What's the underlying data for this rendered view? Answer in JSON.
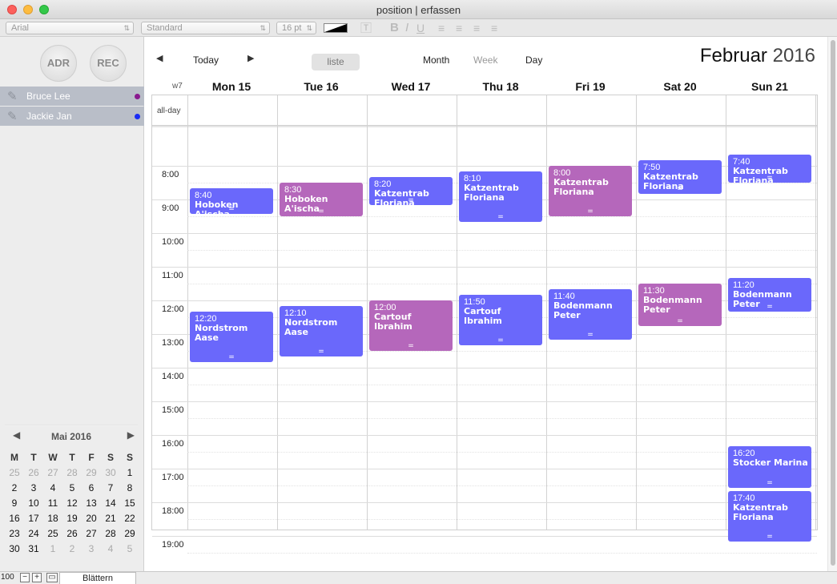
{
  "window": {
    "title": "position | erfassen"
  },
  "format_toolbar": {
    "font": "Arial",
    "style": "Standard",
    "size": "16 pt"
  },
  "sidebar": {
    "buttons": [
      {
        "label": "ADR"
      },
      {
        "label": "REC"
      }
    ],
    "persons": [
      {
        "name": "Bruce Lee",
        "dot_color": "#8a1a8f"
      },
      {
        "name": "Jackie Jan",
        "dot_color": "#1a2cf5"
      }
    ]
  },
  "mini_calendar": {
    "title": "Mai 2016",
    "dow": [
      "M",
      "T",
      "W",
      "T",
      "F",
      "S",
      "S"
    ],
    "weeks": [
      [
        {
          "d": "25",
          "dim": true
        },
        {
          "d": "26",
          "dim": true
        },
        {
          "d": "27",
          "dim": true
        },
        {
          "d": "28",
          "dim": true
        },
        {
          "d": "29",
          "dim": true
        },
        {
          "d": "30",
          "dim": true
        },
        {
          "d": "1",
          "dim": false
        }
      ],
      [
        {
          "d": "2",
          "dim": false
        },
        {
          "d": "3",
          "dim": false
        },
        {
          "d": "4",
          "dim": false
        },
        {
          "d": "5",
          "dim": false
        },
        {
          "d": "6",
          "dim": false
        },
        {
          "d": "7",
          "dim": false
        },
        {
          "d": "8",
          "dim": false
        }
      ],
      [
        {
          "d": "9",
          "dim": false
        },
        {
          "d": "10",
          "dim": false
        },
        {
          "d": "11",
          "dim": false
        },
        {
          "d": "12",
          "dim": false
        },
        {
          "d": "13",
          "dim": false
        },
        {
          "d": "14",
          "dim": false
        },
        {
          "d": "15",
          "dim": false
        }
      ],
      [
        {
          "d": "16",
          "dim": false
        },
        {
          "d": "17",
          "dim": false
        },
        {
          "d": "18",
          "dim": false
        },
        {
          "d": "19",
          "dim": false
        },
        {
          "d": "20",
          "dim": false
        },
        {
          "d": "21",
          "dim": false
        },
        {
          "d": "22",
          "dim": false
        }
      ],
      [
        {
          "d": "23",
          "dim": false
        },
        {
          "d": "24",
          "dim": false
        },
        {
          "d": "25",
          "dim": false
        },
        {
          "d": "26",
          "dim": false
        },
        {
          "d": "27",
          "dim": false
        },
        {
          "d": "28",
          "dim": false
        },
        {
          "d": "29",
          "dim": false
        }
      ],
      [
        {
          "d": "30",
          "dim": false
        },
        {
          "d": "31",
          "dim": false
        },
        {
          "d": "1",
          "dim": true
        },
        {
          "d": "2",
          "dim": true
        },
        {
          "d": "3",
          "dim": true
        },
        {
          "d": "4",
          "dim": true
        },
        {
          "d": "5",
          "dim": true
        }
      ]
    ]
  },
  "bottom_bar": {
    "zoom": "100",
    "tab_label": "Blättern"
  },
  "calendar": {
    "nav": {
      "today": "Today",
      "liste": "liste",
      "month": "Month",
      "week": "Week",
      "day": "Day"
    },
    "month_name": "Februar",
    "year": "2016",
    "week_label": "w7",
    "allday_label": "all-day",
    "days": [
      "Mon 15",
      "Tue 16",
      "Wed 17",
      "Thu 18",
      "Fri 19",
      "Sat 20",
      "Sun 21"
    ],
    "hours": [
      "8:00",
      "9:00",
      "10:00",
      "11:00",
      "12:00",
      "13:00",
      "14:00",
      "15:00",
      "16:00",
      "17:00",
      "18:00",
      "19:00"
    ],
    "handle_glyph": "=",
    "events": [
      {
        "day": 0,
        "start": 8.67,
        "end": 9.42,
        "time": "8:40",
        "title": "Hoboken A'ischa",
        "color": "blue"
      },
      {
        "day": 1,
        "start": 8.5,
        "end": 9.5,
        "time": "8:30",
        "title": "Hoboken A'ischa",
        "color": "purple"
      },
      {
        "day": 2,
        "start": 8.33,
        "end": 9.17,
        "time": "8:20",
        "title": "Katzentrab Floriana",
        "color": "blue"
      },
      {
        "day": 3,
        "start": 8.17,
        "end": 9.67,
        "time": "8:10",
        "title": "Katzentrab Floriana",
        "color": "blue"
      },
      {
        "day": 4,
        "start": 8.0,
        "end": 9.5,
        "time": "8:00",
        "title": "Katzentrab Floriana",
        "color": "purple"
      },
      {
        "day": 5,
        "start": 7.83,
        "end": 8.83,
        "time": "7:50",
        "title": "Katzentrab Floriana",
        "color": "blue"
      },
      {
        "day": 6,
        "start": 7.67,
        "end": 8.5,
        "time": "7:40",
        "title": "Katzentrab Floriana",
        "color": "blue"
      },
      {
        "day": 0,
        "start": 12.33,
        "end": 13.83,
        "time": "12:20",
        "title": "Nordstrom Aase",
        "color": "blue"
      },
      {
        "day": 1,
        "start": 12.17,
        "end": 13.67,
        "time": "12:10",
        "title": "Nordstrom Aase",
        "color": "blue"
      },
      {
        "day": 2,
        "start": 12.0,
        "end": 13.5,
        "time": "12:00",
        "title": "Cartouf Ibrahim",
        "color": "purple"
      },
      {
        "day": 3,
        "start": 11.83,
        "end": 13.33,
        "time": "11:50",
        "title": "Cartouf Ibrahim",
        "color": "blue"
      },
      {
        "day": 4,
        "start": 11.67,
        "end": 13.17,
        "time": "11:40",
        "title": "Bodenmann Peter",
        "color": "blue"
      },
      {
        "day": 5,
        "start": 11.5,
        "end": 12.75,
        "time": "11:30",
        "title": "Bodenmann Peter",
        "color": "purple"
      },
      {
        "day": 6,
        "start": 11.33,
        "end": 12.33,
        "time": "11:20",
        "title": "Bodenmann Peter",
        "color": "blue"
      },
      {
        "day": 6,
        "start": 16.33,
        "end": 17.58,
        "time": "16:20",
        "title": "Stocker Marina",
        "color": "blue"
      },
      {
        "day": 6,
        "start": 17.67,
        "end": 19.17,
        "time": "17:40",
        "title": "Katzentrab Floriana",
        "color": "blue"
      }
    ]
  }
}
